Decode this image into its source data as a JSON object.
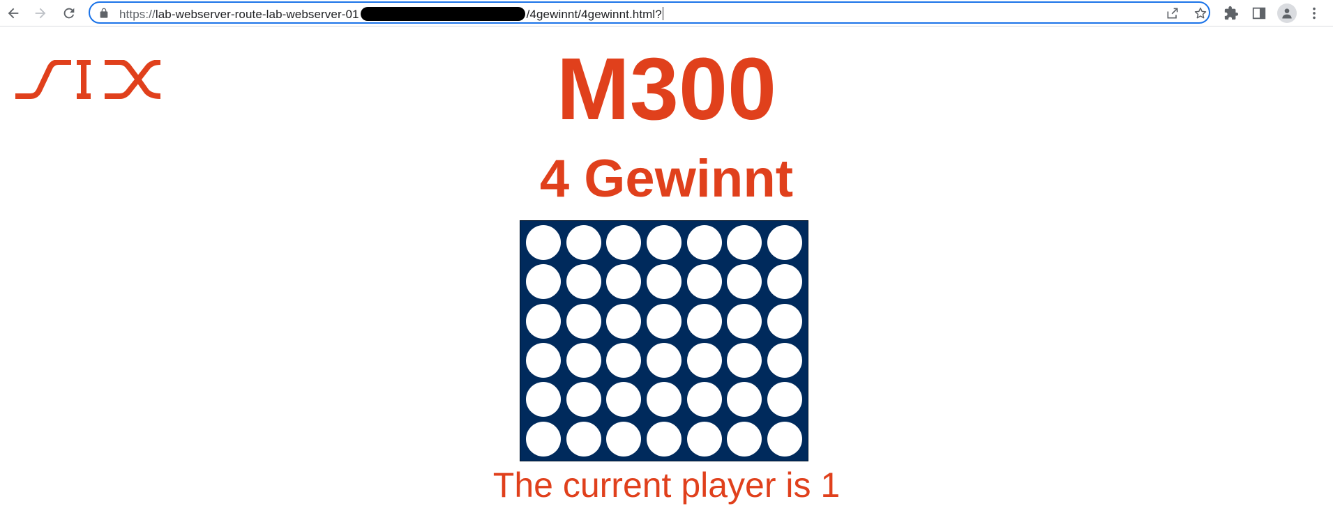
{
  "browser": {
    "url_scheme": "https://",
    "url_start": "lab-webserver-route-lab-webserver-01",
    "url_end": "/4gewinnt/4gewinnt.html?"
  },
  "page": {
    "logo_text": "SIX",
    "title": "M300",
    "subtitle": "4 Gewinnt",
    "status_text": "The current player is 1"
  },
  "board": {
    "columns": 7,
    "rows": 6,
    "cell_color": "#ffffff",
    "board_color": "#002a5c"
  },
  "colors": {
    "accent": "#e0401c",
    "omnibox_border": "#1a73e8"
  }
}
